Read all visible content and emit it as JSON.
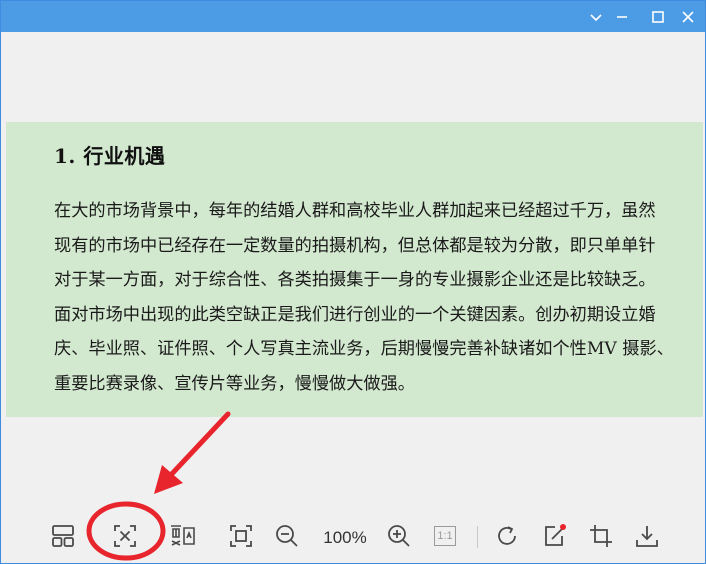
{
  "window": {
    "controls": {
      "dropdown": "chevron-down-icon",
      "minimize": "minimize-icon",
      "maximize": "maximize-icon",
      "close": "close-icon"
    }
  },
  "document": {
    "heading": "1. 行业机遇",
    "lines": [
      "在大的市场背景中，每年的结婚人群和高校毕业人群加起来已经超过千万，虽然",
      "现有的市场中已经存在一定数量的拍摄机构，但总体都是较为分散，即只单单针",
      "对于某一方面，对于综合性、各类拍摄集于一身的专业摄影企业还是比较缺乏。",
      "面对市场中出现的此类空缺正是我们进行创业的一个关键因素。创办初期设立婚",
      "庆、毕业照、证件照、个人写真主流业务，后期慢慢完善补缺诸如个性MV 摄影、",
      "重要比赛录像、宣传片等业务，慢慢做大做强。"
    ],
    "background_color": "#d3e9cf"
  },
  "toolbar": {
    "zoom_level": "100%",
    "tools": [
      "layout-icon",
      "extract-text-icon",
      "ocr-icon",
      "fit-window-icon",
      "zoom-out-icon",
      "zoom-in-icon",
      "actual-size-icon",
      "rotate-icon",
      "edit-icon",
      "crop-icon",
      "download-icon"
    ],
    "actual_size_label": "1:1"
  },
  "annotation": {
    "highlight": "extract-text-icon",
    "color": "#e8242c"
  },
  "colors": {
    "titlebar": "#4c9be5",
    "background": "#f0f0f0",
    "icon": "#4a4a4a"
  }
}
